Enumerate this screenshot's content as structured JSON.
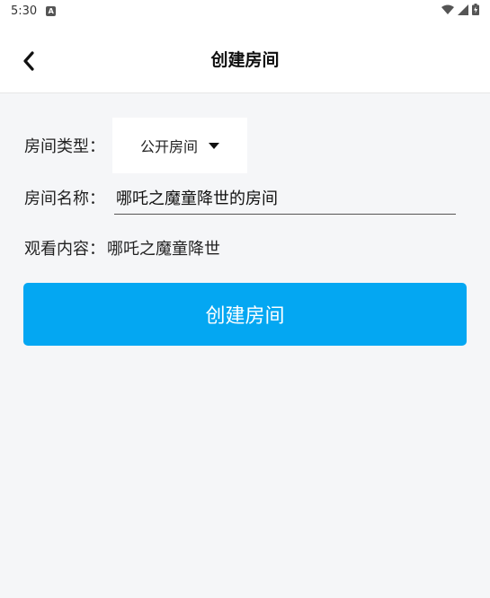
{
  "status_bar": {
    "time": "5:30",
    "notification_icon": "A"
  },
  "header": {
    "title": "创建房间",
    "back_icon": "chevron-left-icon"
  },
  "form": {
    "room_type": {
      "label": "房间类型：",
      "selected": "公开房间"
    },
    "room_name": {
      "label": "房间名称：",
      "value": "哪吒之魔童降世的房间"
    },
    "watch_content": {
      "label": "观看内容：",
      "value": "哪吒之魔童降世"
    }
  },
  "create_button": {
    "label": "创建房间",
    "color": "#04a7f2"
  }
}
